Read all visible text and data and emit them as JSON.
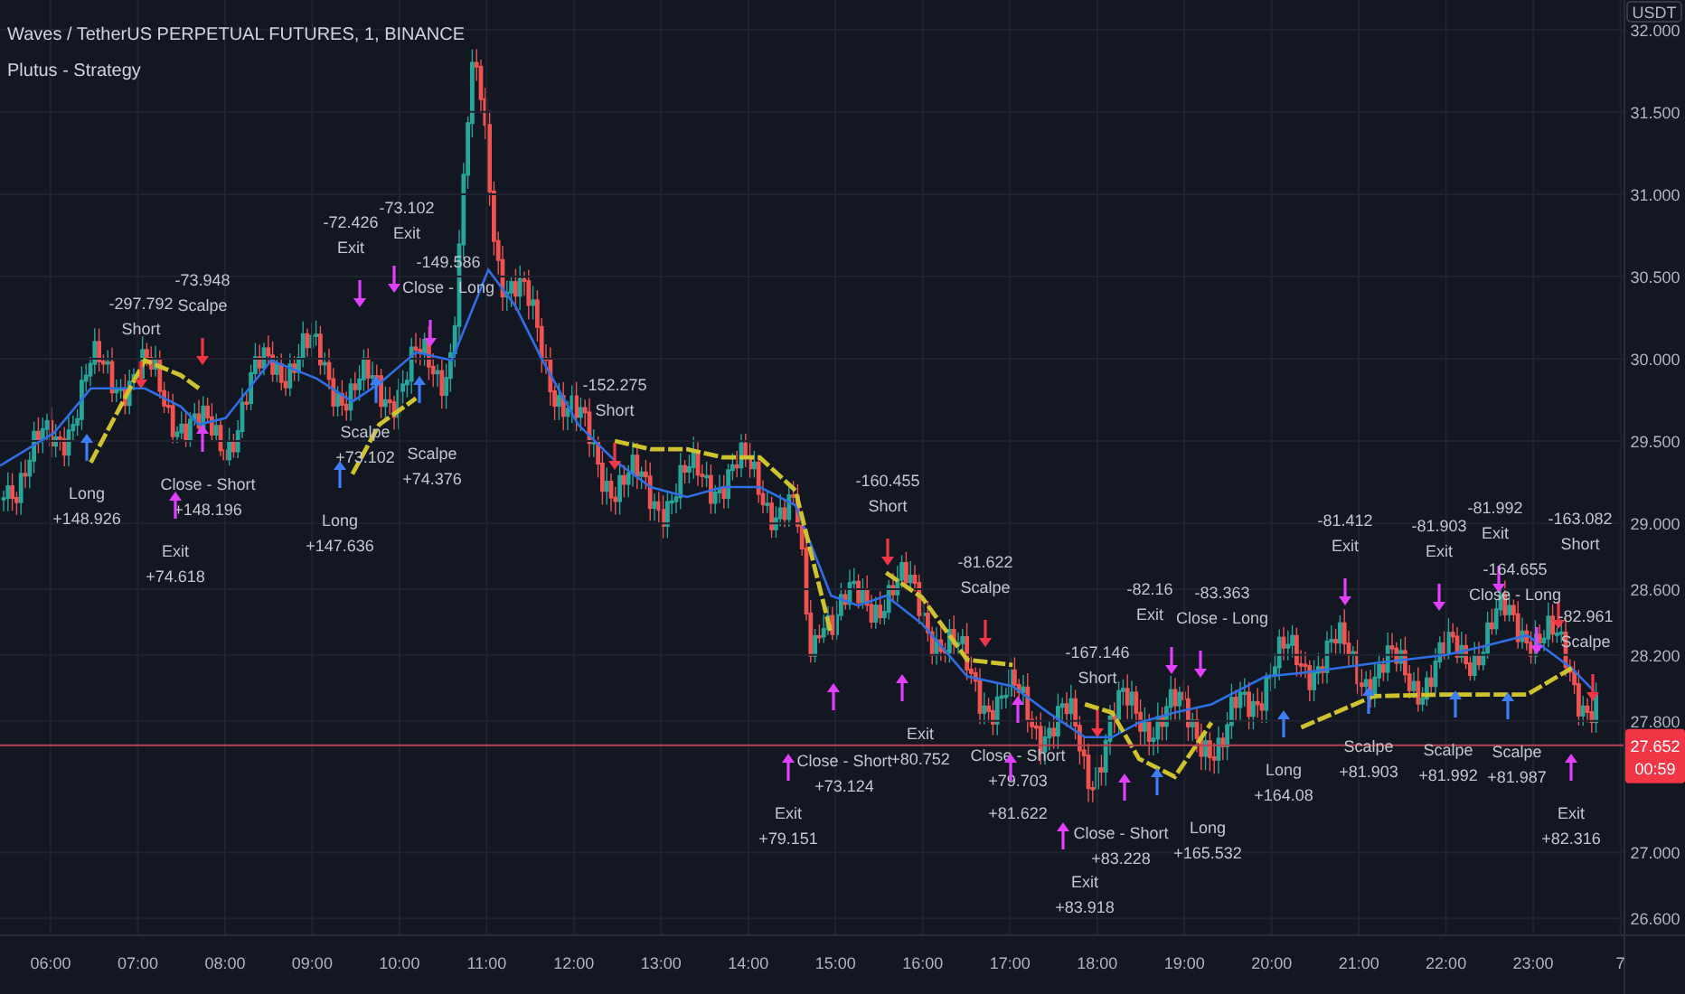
{
  "legend": {
    "symbol": "Waves / TetherUS PERPETUAL FUTURES, 1, BINANCE",
    "indicator": "Plutus - Strategy"
  },
  "price_axis": {
    "currency": "USDT"
  },
  "time_axis": {
    "day_label": "7"
  },
  "last_price": {
    "value": "27.652",
    "countdown": "00:59"
  },
  "chart_data": {
    "type": "line",
    "grid": true,
    "x": [
      5.42,
      6.04,
      6.46,
      7.08,
      7.49,
      7.7,
      8.01,
      8.53,
      9.05,
      9.46,
      9.77,
      10.19,
      10.6,
      11.02,
      11.33,
      11.64,
      12.05,
      12.47,
      12.88,
      13.3,
      13.71,
      14.13,
      14.54,
      14.95,
      15.26,
      15.58,
      15.99,
      16.51,
      17.03,
      17.44,
      17.86,
      18.17,
      18.48,
      18.89,
      19.31,
      19.93,
      20.34,
      21.17,
      22.0,
      22.41,
      22.93,
      23.44,
      23.7
    ],
    "series": [
      {
        "color": "#2f6fe6",
        "values": [
          29.35,
          29.55,
          29.82,
          29.82,
          29.71,
          29.6,
          29.64,
          29.99,
          29.88,
          29.74,
          29.85,
          30.04,
          29.99,
          30.54,
          30.32,
          29.99,
          29.6,
          29.38,
          29.22,
          29.16,
          29.22,
          29.22,
          29.11,
          28.56,
          28.5,
          28.56,
          28.39,
          28.07,
          28.01,
          27.85,
          27.7,
          27.7,
          27.79,
          27.85,
          27.9,
          28.07,
          28.09,
          28.15,
          28.2,
          28.25,
          28.32,
          28.12,
          27.98
        ]
      },
      {
        "color": "#cfc22f",
        "line_style": "dashed",
        "values": [
          null,
          null,
          29.37,
          29.99,
          29.9,
          29.82,
          null,
          null,
          null,
          29.3,
          29.6,
          29.76,
          null,
          null,
          null,
          null,
          null,
          29.5,
          29.45,
          29.45,
          29.4,
          29.4,
          29.2,
          28.33,
          null,
          28.7,
          28.55,
          28.17,
          28.14,
          null,
          27.9,
          27.85,
          27.57,
          27.46,
          27.79,
          null,
          27.76,
          27.95,
          27.96,
          27.96,
          27.96,
          28.12,
          null
        ]
      }
    ],
    "ref_lines": [
      {
        "axis": "y",
        "value": 27.652,
        "color": "#b8434f"
      }
    ],
    "xlim": [
      5.42,
      24.74
    ],
    "ylim": [
      26.14,
      32.18
    ],
    "xticks": [
      {
        "value": 6,
        "label": "06:00"
      },
      {
        "value": 7,
        "label": "07:00"
      },
      {
        "value": 8,
        "label": "08:00"
      },
      {
        "value": 9,
        "label": "09:00"
      },
      {
        "value": 10,
        "label": "10:00"
      },
      {
        "value": 11,
        "label": "11:00"
      },
      {
        "value": 12,
        "label": "12:00"
      },
      {
        "value": 13,
        "label": "13:00"
      },
      {
        "value": 14,
        "label": "14:00"
      },
      {
        "value": 15,
        "label": "15:00"
      },
      {
        "value": 16,
        "label": "16:00"
      },
      {
        "value": 17,
        "label": "17:00"
      },
      {
        "value": 18,
        "label": "18:00"
      },
      {
        "value": 19,
        "label": "19:00"
      },
      {
        "value": 20,
        "label": "20:00"
      },
      {
        "value": 21,
        "label": "21:00"
      },
      {
        "value": 22,
        "label": "22:00"
      },
      {
        "value": 23,
        "label": "23:00"
      }
    ],
    "yticks": [
      {
        "value": 32,
        "label": "32.000"
      },
      {
        "value": 31.5,
        "label": "31.500"
      },
      {
        "value": 31,
        "label": "31.000"
      },
      {
        "value": 30.5,
        "label": "30.500"
      },
      {
        "value": 30,
        "label": "30.000"
      },
      {
        "value": 29.5,
        "label": "29.500"
      },
      {
        "value": 29,
        "label": "29.000"
      },
      {
        "value": 28.6,
        "label": "28.600"
      },
      {
        "value": 28.2,
        "label": "28.200"
      },
      {
        "value": 27.8,
        "label": "27.800"
      },
      {
        "value": 27,
        "label": "27.000"
      },
      {
        "value": 26.6,
        "label": "26.600"
      }
    ]
  },
  "trades": [
    {
      "kind": "buy",
      "texts": [
        "Long",
        "+148.926"
      ]
    },
    {
      "kind": "sell",
      "texts": [
        "-297.792",
        "Short"
      ]
    },
    {
      "kind": "sell",
      "texts": [
        "-73.948",
        "Scalpe"
      ]
    },
    {
      "kind": "close-up",
      "texts": [
        "Close - Short",
        "+148.196"
      ]
    },
    {
      "kind": "close-up",
      "texts": [
        "Exit",
        "+74.618"
      ]
    },
    {
      "kind": "close-down",
      "texts": [
        "-72.426",
        "Exit"
      ]
    },
    {
      "kind": "close-down",
      "texts": [
        "-73.102",
        "Exit"
      ]
    },
    {
      "kind": "close-down",
      "texts": [
        "-149.586",
        "Close - Long"
      ]
    },
    {
      "kind": "buy",
      "texts": [
        "Scalpe",
        "+73.102"
      ]
    },
    {
      "kind": "buy",
      "texts": [
        "Long",
        "+147.636"
      ]
    },
    {
      "kind": "buy",
      "texts": [
        "Scalpe",
        "+74.376"
      ]
    },
    {
      "kind": "sell",
      "texts": [
        "-152.275",
        "Short"
      ]
    },
    {
      "kind": "sell",
      "texts": [
        "-160.455",
        "Short"
      ]
    },
    {
      "kind": "sell",
      "texts": [
        "-81.622",
        "Scalpe"
      ]
    },
    {
      "kind": "close-up",
      "texts": [
        "Close - Short",
        "+73.124"
      ]
    },
    {
      "kind": "close-up",
      "texts": [
        "Exit",
        "+79.151"
      ]
    },
    {
      "kind": "close-up",
      "texts": [
        "Exit",
        "+80.752"
      ]
    },
    {
      "kind": "close-up",
      "texts": [
        "Close - Short",
        "+79.703"
      ]
    },
    {
      "kind": "close-up",
      "texts": [
        "+81.622"
      ]
    },
    {
      "kind": "sell",
      "texts": [
        "-167.146",
        "Short"
      ]
    },
    {
      "kind": "close-up",
      "texts": [
        "Close - Short",
        "+83.228"
      ]
    },
    {
      "kind": "close-up",
      "texts": [
        "Exit",
        "+83.918"
      ]
    },
    {
      "kind": "buy",
      "texts": [
        "Long",
        "+165.532"
      ]
    },
    {
      "kind": "close-down",
      "texts": [
        "-82.16",
        "Exit"
      ]
    },
    {
      "kind": "close-down",
      "texts": [
        "-83.363",
        "Close - Long"
      ]
    },
    {
      "kind": "buy",
      "texts": [
        "Long",
        "+164.08"
      ]
    },
    {
      "kind": "close-down",
      "texts": [
        "-81.412",
        "Exit"
      ]
    },
    {
      "kind": "buy",
      "texts": [
        "Scalpe",
        "+81.903"
      ]
    },
    {
      "kind": "close-down",
      "texts": [
        "-81.903",
        "Exit"
      ]
    },
    {
      "kind": "buy",
      "texts": [
        "Scalpe",
        "+81.992"
      ]
    },
    {
      "kind": "close-down",
      "texts": [
        "-81.992",
        "Exit"
      ]
    },
    {
      "kind": "buy",
      "texts": [
        "Scalpe",
        "+81.987"
      ]
    },
    {
      "kind": "sell",
      "texts": [
        "-163.082",
        "Short"
      ]
    },
    {
      "kind": "close-down",
      "texts": [
        "-164.655",
        "Close - Long"
      ]
    },
    {
      "kind": "sell",
      "texts": [
        "-82.961",
        "Scalpe"
      ]
    },
    {
      "kind": "close-up",
      "texts": [
        "Exit",
        "+82.316"
      ]
    }
  ]
}
